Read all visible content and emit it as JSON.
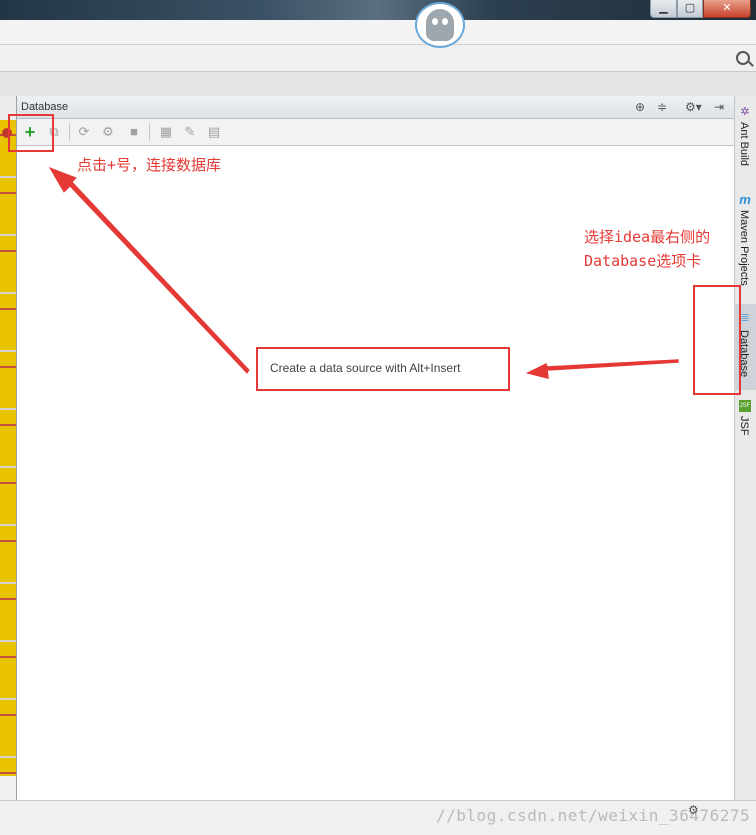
{
  "window": {
    "min_glyph": "▁",
    "max_glyph": "▢",
    "close_glyph": "✕"
  },
  "database_panel": {
    "title": "Database",
    "empty_message": "Create a data source with Alt+Insert",
    "toolbar": {
      "add_glyph": "+",
      "copy_glyph": "⧉",
      "refresh_glyph": "⟳",
      "properties_glyph": "⚙",
      "stop_glyph": "■",
      "table_glyph": "▦",
      "edit_glyph": "✎",
      "console_glyph": "▤"
    },
    "header_icons": {
      "target_glyph": "⊕",
      "collapse_glyph": "≑",
      "settings_glyph": "⚙▾",
      "hide_glyph": "⇥"
    }
  },
  "right_stripe": {
    "tabs": [
      {
        "label": "Ant Build",
        "icon": "ant-icon",
        "glyph": "✲",
        "active": false
      },
      {
        "label": "Maven Projects",
        "icon": "maven-icon",
        "glyph": "m",
        "active": false
      },
      {
        "label": "Database",
        "icon": "database-icon",
        "glyph": "≣",
        "active": true
      },
      {
        "label": "JSF",
        "icon": "jsf-icon",
        "glyph": "JSF",
        "active": false
      }
    ]
  },
  "status": {
    "settings_glyph": "⚙",
    "watermark": "//blog.csdn.net/weixin_36476275"
  },
  "annotations": {
    "add_hint": "点击+号，连接数据库",
    "tab_hint_line1": "选择idea最右侧的",
    "tab_hint_line2": "Database选项卡",
    "color": "#e53935"
  }
}
